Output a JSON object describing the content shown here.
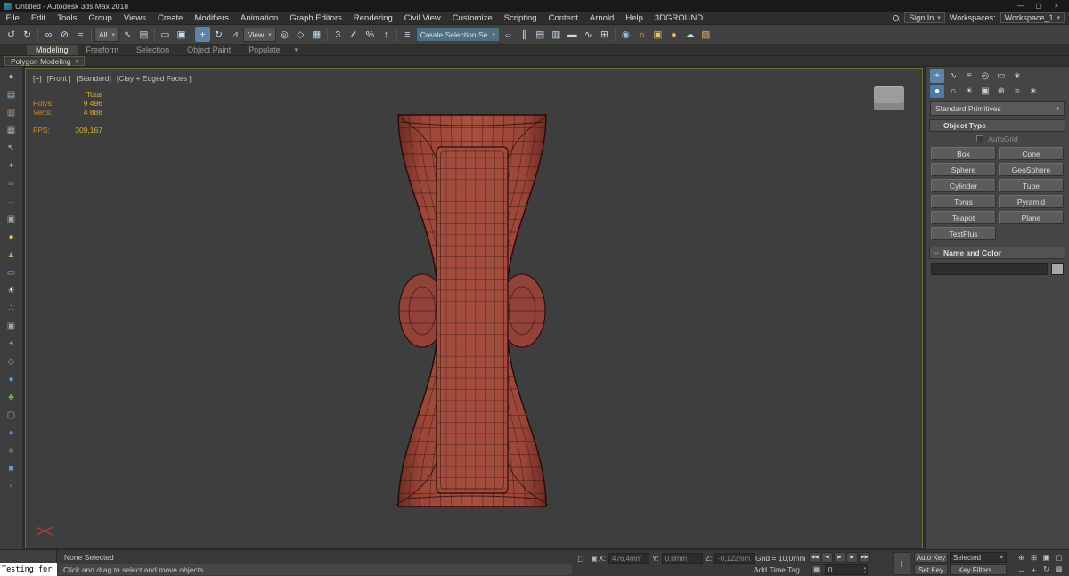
{
  "window": {
    "title": "Untitled - Autodesk 3ds Max 2018"
  },
  "menu": {
    "items": [
      "File",
      "Edit",
      "Tools",
      "Group",
      "Views",
      "Create",
      "Modifiers",
      "Animation",
      "Graph Editors",
      "Rendering",
      "Civil View",
      "Customize",
      "Scripting",
      "Content",
      "Arnold",
      "Help",
      "3DGROUND"
    ],
    "sign_in": "Sign In",
    "workspaces_label": "Workspaces:",
    "workspace_value": "Workspace_1"
  },
  "toolbar": {
    "filter_value": "All",
    "coord_value": "View",
    "selection_set_value": "Create Selection Se",
    "groups": {
      "history": [
        {
          "n": "undo",
          "g": "↺",
          "c": "#c9dff0"
        },
        {
          "n": "redo",
          "g": "↻",
          "c": "#c9dff0"
        }
      ],
      "link": [
        {
          "n": "select-and-link",
          "g": "∞",
          "c": "#c9dff0"
        },
        {
          "n": "unlink-selection",
          "g": "⊘",
          "c": "#c9dff0"
        },
        {
          "n": "bind-to-space-warp",
          "g": "≈",
          "c": "#c9dff0"
        }
      ],
      "select": [
        {
          "n": "select-object",
          "g": "↖",
          "c": "#c9dff0"
        },
        {
          "n": "select-by-name",
          "g": "▤",
          "c": "#c9dff0"
        }
      ],
      "region": [
        {
          "n": "rectangular-selection-region",
          "g": "▭",
          "c": "#c9dff0"
        },
        {
          "n": "window-crossing-toggle",
          "g": "▣",
          "c": "#c9dff0"
        }
      ],
      "transform": [
        {
          "n": "select-and-move",
          "g": "+",
          "c": "#ffffff",
          "a": 1
        },
        {
          "n": "select-and-rotate",
          "g": "↻",
          "c": "#c9dff0"
        },
        {
          "n": "select-and-scale",
          "g": "⊿",
          "c": "#c9dff0"
        }
      ],
      "pivot": [
        {
          "n": "use-pivot-point-center",
          "g": "◎",
          "c": "#c9dff0"
        },
        {
          "n": "select-and-manipulate",
          "g": "◇",
          "c": "#c9dff0"
        },
        {
          "n": "keyboard-shortcut-override",
          "g": "▦",
          "c": "#c9dff0"
        }
      ],
      "snaps": [
        {
          "n": "snaps-toggle-3d",
          "g": "3",
          "c": "#c9dff0"
        },
        {
          "n": "angle-snap-toggle",
          "g": "∠",
          "c": "#c9dff0"
        },
        {
          "n": "percent-snap-toggle",
          "g": "%",
          "c": "#c9dff0"
        },
        {
          "n": "spinner-snap-toggle",
          "g": "↕",
          "c": "#c9dff0"
        }
      ],
      "sets": [
        {
          "n": "edit-named-selection-sets",
          "g": "≡",
          "c": "#c9dff0"
        }
      ],
      "tools": [
        {
          "n": "mirror",
          "g": "⇔",
          "c": "#c9dff0"
        },
        {
          "n": "align",
          "g": "∥",
          "c": "#c9dff0"
        },
        {
          "n": "toggle-scene-explorer",
          "g": "▤",
          "c": "#c9dff0"
        },
        {
          "n": "toggle-layer-explorer",
          "g": "▥",
          "c": "#c9dff0"
        },
        {
          "n": "toggle-ribbon",
          "g": "▬",
          "c": "#c9dff0"
        },
        {
          "n": "curve-editor",
          "g": "∿",
          "c": "#c9dff0"
        },
        {
          "n": "schematic-view",
          "g": "⊞",
          "c": "#c9dff0"
        }
      ],
      "render": [
        {
          "n": "material-editor",
          "g": "◉",
          "c": "#8fc0e8"
        },
        {
          "n": "render-setup",
          "g": "☼",
          "c": "#e9c45c"
        },
        {
          "n": "rendered-frame-window",
          "g": "▣",
          "c": "#e9c45c"
        },
        {
          "n": "render-production",
          "g": "●",
          "c": "#e9c45c"
        },
        {
          "n": "render-in-cloud",
          "g": "☁",
          "c": "#c9dff0"
        },
        {
          "n": "scene-converter",
          "g": "▨",
          "c": "#e9c45c"
        }
      ]
    }
  },
  "ribbon": {
    "tabs": [
      "Modeling",
      "Freeform",
      "Selection",
      "Object Paint",
      "Populate"
    ],
    "panel_chip": "Polygon Modeling"
  },
  "left_toolbar": {
    "icons": [
      {
        "n": "pointer-tool",
        "g": "●",
        "c": "#b8b8b8"
      },
      {
        "n": "document-tool",
        "g": "▤",
        "c": "#8fb3d1"
      },
      {
        "n": "layers-tool",
        "g": "▥",
        "c": "#a6a6a6"
      },
      {
        "n": "grid-tool",
        "g": "▦",
        "c": "#a6a6a6"
      },
      {
        "n": "select-arrow-tool",
        "g": "↖",
        "c": "#b8b8b8"
      },
      {
        "n": "move-cross-tool",
        "g": "+",
        "c": "#b8b8b8"
      },
      {
        "n": "link-chain-tool",
        "g": "∞",
        "c": "#b37a7a"
      },
      {
        "n": "particle-dots-tool",
        "g": "∴",
        "c": "#cc6a6a"
      },
      {
        "n": "square-frame-tool",
        "g": "▣",
        "c": "#a6a6a6"
      },
      {
        "n": "yellow-sphere-tool",
        "g": "●",
        "c": "#e3c44f"
      },
      {
        "n": "cone-tool",
        "g": "▲",
        "c": "#c9a171"
      },
      {
        "n": "plane-tool",
        "g": "▭",
        "c": "#a6a6a6"
      },
      {
        "n": "light-bulb-tool",
        "g": "☀",
        "c": "#e6e6e6"
      },
      {
        "n": "orange-particles-tool",
        "g": "∴",
        "c": "#d98a3d"
      },
      {
        "n": "camera-frame-tool",
        "g": "▣",
        "c": "#a6a6a6"
      },
      {
        "n": "helper-cross-tool",
        "g": "+",
        "c": "#a6a6a6"
      },
      {
        "n": "diamond-tool",
        "g": "◇",
        "c": "#a6a6a6"
      },
      {
        "n": "blue-sphere-tool",
        "g": "●",
        "c": "#63a3d8"
      },
      {
        "n": "foliage-tool",
        "g": "♣",
        "c": "#74b254"
      },
      {
        "n": "outline-box-tool",
        "g": "▢",
        "c": "#a6a6a6"
      },
      {
        "n": "blue-dot-tool",
        "g": "●",
        "c": "#5585d4"
      },
      {
        "n": "dark-square-tool",
        "g": "■",
        "c": "#6a6a6a"
      },
      {
        "n": "blue-cube-tool",
        "g": "■",
        "c": "#7495d6"
      },
      {
        "n": "gray-box-tool",
        "g": "▫",
        "c": "#a6a6a6"
      }
    ]
  },
  "viewport": {
    "label": {
      "plus": "[+]",
      "view": "[Front ]",
      "renderer": "[Standard]",
      "shading": "[Clay + Edged Faces ]"
    },
    "stats": {
      "rows": [
        {
          "l": "",
          "v": "Total"
        },
        {
          "l": "Polys:",
          "v": "9 496"
        },
        {
          "l": "Verts:",
          "v": "4 888"
        },
        {
          "l": "FPS:",
          "v": "309,167"
        }
      ]
    }
  },
  "command_panel": {
    "tab_rows": {
      "main": [
        {
          "n": "create-tab",
          "g": "+",
          "c": "#e8e8e8",
          "a": 1
        },
        {
          "n": "modify-tab",
          "g": "∿",
          "c": "#cfcfcf"
        },
        {
          "n": "hierarchy-tab",
          "g": "≡",
          "c": "#cfcfcf"
        },
        {
          "n": "motion-tab",
          "g": "◎",
          "c": "#cfcfcf"
        },
        {
          "n": "display-tab",
          "g": "▭",
          "c": "#cfcfcf"
        },
        {
          "n": "utilities-tab",
          "g": "∗",
          "c": "#cfcfcf"
        }
      ],
      "sub": [
        {
          "n": "geometry-category",
          "g": "●",
          "c": "#ffffff",
          "a": 1
        },
        {
          "n": "shapes-category",
          "g": "∩",
          "c": "#cfcfcf"
        },
        {
          "n": "lights-category",
          "g": "☀",
          "c": "#cfcfcf"
        },
        {
          "n": "cameras-category",
          "g": "▣",
          "c": "#cfcfcf"
        },
        {
          "n": "helpers-category",
          "g": "⊕",
          "c": "#cfcfcf"
        },
        {
          "n": "space-warps-category",
          "g": "≈",
          "c": "#cfcfcf"
        },
        {
          "n": "systems-category",
          "g": "∗",
          "c": "#cfcfcf"
        }
      ]
    },
    "category_value": "Standard Primitives",
    "object_type_title": "Object Type",
    "autogrid_label": "AutoGrid",
    "primitive_buttons": [
      "Box",
      "Cone",
      "Sphere",
      "GeoSphere",
      "Cylinder",
      "Tube",
      "Torus",
      "Pyramid",
      "Teapot",
      "Plane",
      "TextPlus"
    ],
    "name_color_title": "Name and Color"
  },
  "status_bar": {
    "listener_text": "Testing for",
    "selection_status": "None Selected",
    "prompt": "Click and drag to select and move objects",
    "coords": {
      "x_label": "X:",
      "x": "476,4mm",
      "y_label": "Y:",
      "y": "0,0mm",
      "z_label": "Z:",
      "z": "-0,122mm"
    },
    "grid_label": "Grid = 10,0mm",
    "add_time_tag": "Add Time Tag",
    "transport": [
      {
        "n": "go-to-start",
        "g": "◀◀"
      },
      {
        "n": "previous-frame",
        "g": "◀"
      },
      {
        "n": "play-animation",
        "g": "▶"
      },
      {
        "n": "next-frame",
        "g": "▶"
      },
      {
        "n": "go-to-end",
        "g": "▶▶"
      }
    ],
    "frame_value": "0",
    "auto_key": "Auto Key",
    "selected_value": "Selected",
    "set_key": "Set Key",
    "key_filters": "Key Filters...",
    "status_icons": [
      {
        "n": "isolate-selection-toggle",
        "g": "▢"
      },
      {
        "n": "selection-lock-toggle",
        "g": "▣"
      }
    ],
    "nav_icons": [
      {
        "n": "zoom",
        "g": "⊕"
      },
      {
        "n": "zoom-all",
        "g": "⊞"
      },
      {
        "n": "zoom-extents",
        "g": "▣"
      },
      {
        "n": "zoom-extents-all",
        "g": "▢"
      },
      {
        "n": "field-of-view",
        "g": "↔"
      },
      {
        "n": "pan-view",
        "g": "+"
      },
      {
        "n": "orbit-viewport",
        "g": "↻"
      },
      {
        "n": "maximize-viewport-toggle",
        "g": "▦"
      }
    ]
  }
}
